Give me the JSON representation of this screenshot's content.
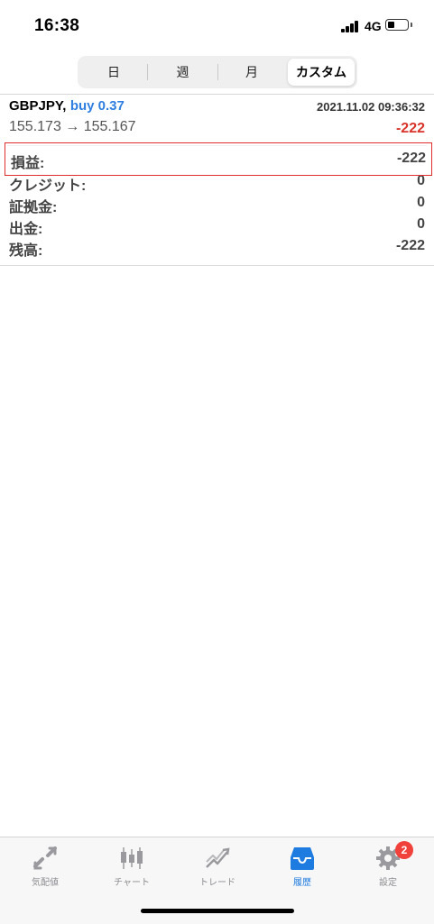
{
  "status_bar": {
    "time": "16:38",
    "network": "4G"
  },
  "segment": {
    "items": [
      "日",
      "週",
      "月",
      "カスタム"
    ],
    "selected": "カスタム"
  },
  "entry": {
    "symbol": "GBPJPY,",
    "side": "buy 0.37",
    "datetime": "2021.11.02 09:36:32",
    "prices": "155.173 → 155.167",
    "profit": "-222",
    "details": [
      {
        "label": "損益:",
        "value": "-222"
      },
      {
        "label": "クレジット:",
        "value": "0"
      },
      {
        "label": "証拠金:",
        "value": "0"
      },
      {
        "label": "出金:",
        "value": "0"
      },
      {
        "label": "残高:",
        "value": "-222"
      }
    ]
  },
  "tabbar": {
    "items": [
      {
        "label": "気配値",
        "icon": "quotes-icon"
      },
      {
        "label": "チャート",
        "icon": "chart-icon"
      },
      {
        "label": "トレード",
        "icon": "trade-icon"
      },
      {
        "label": "履歴",
        "icon": "history-icon"
      },
      {
        "label": "設定",
        "icon": "settings-icon"
      }
    ],
    "active": "履歴",
    "settings_badge": "2"
  },
  "colors": {
    "accent": "#1e7be0",
    "loss": "#d9342b",
    "highlight_border": "#e02d2d"
  }
}
